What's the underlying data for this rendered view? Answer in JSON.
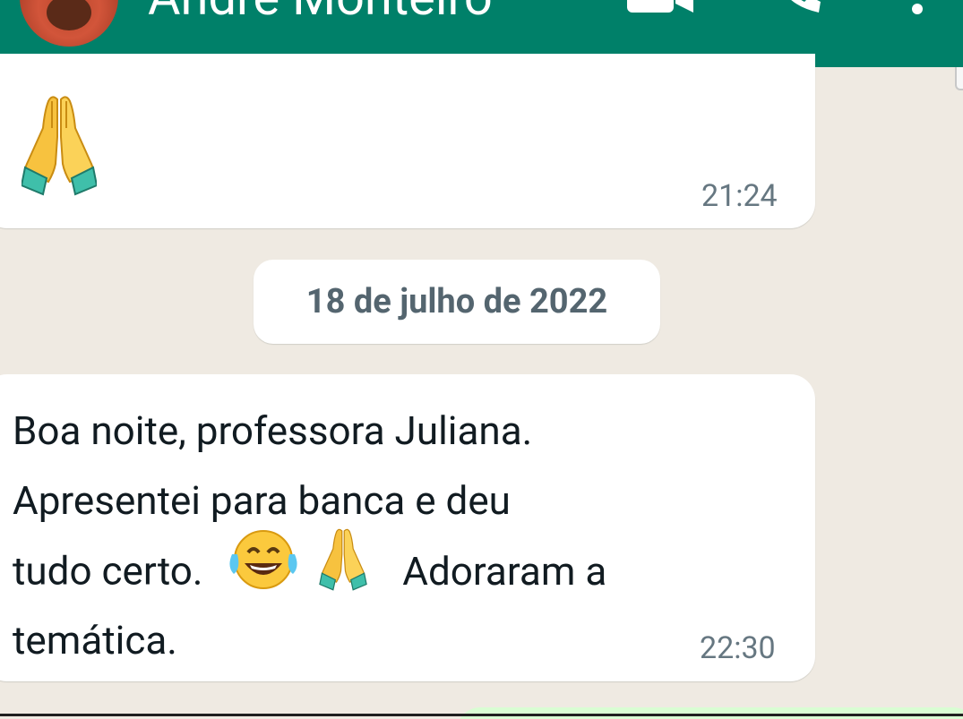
{
  "header": {
    "contact_name": "André Monteiro",
    "background_color": "#008069",
    "icons": {
      "avatar": "avatar",
      "video": "video-call-icon",
      "call": "phone-icon",
      "menu": "more-vert-icon"
    }
  },
  "messages": [
    {
      "type": "incoming",
      "content": "emoji",
      "emoji": "folded-hands",
      "time": "21:24"
    },
    {
      "type": "incoming",
      "lines": [
        "Boa noite, professora Juliana.",
        "Apresentei para banca e deu",
        "tudo certo.",
        "Adoraram a",
        "temática."
      ],
      "emojis": [
        "face-with-tears-of-joy",
        "folded-hands"
      ],
      "time": "22:30"
    }
  ],
  "date_divider": "18 de julho de 2022",
  "colors": {
    "chat_background": "#efeae2",
    "incoming_bubble": "#ffffff",
    "outgoing_bubble": "#d9fdd3",
    "time_text": "#667781",
    "date_text": "#54656f"
  }
}
